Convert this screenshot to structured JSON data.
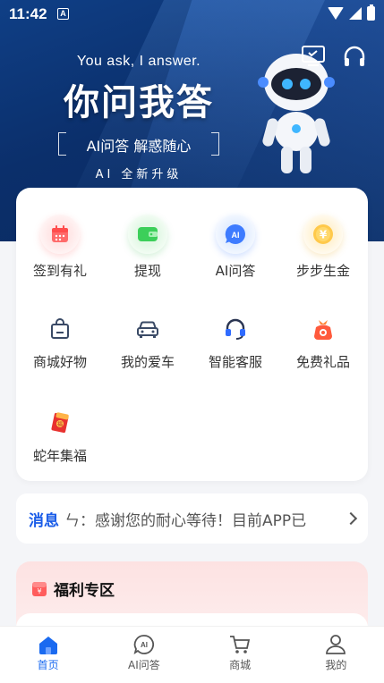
{
  "status_bar": {
    "time": "11:42",
    "notification_badge": "A"
  },
  "hero": {
    "subtitle": "You ask, I answer.",
    "title": "你问我答",
    "tagline": "AI问答 解惑随心",
    "upgrade": "AI 全新升级"
  },
  "menu": [
    {
      "label": "签到有礼",
      "icon": "calendar-icon"
    },
    {
      "label": "提现",
      "icon": "wallet-icon"
    },
    {
      "label": "AI问答",
      "icon": "ai-chat-icon"
    },
    {
      "label": "步步生金",
      "icon": "coin-icon"
    },
    {
      "label": "商城好物",
      "icon": "shopping-bag-icon"
    },
    {
      "label": "我的爱车",
      "icon": "car-icon"
    },
    {
      "label": "智能客服",
      "icon": "headset-icon"
    },
    {
      "label": "免费礼品",
      "icon": "gift-bag-icon"
    },
    {
      "label": "蛇年集福",
      "icon": "red-envelope-icon"
    }
  ],
  "message": {
    "title": "消息",
    "text": "ㄣ：感谢您的耐心等待！目前APP已"
  },
  "welfare": {
    "title": "福利专区"
  },
  "tabs": [
    {
      "label": "首页",
      "icon": "home-icon",
      "active": true
    },
    {
      "label": "AI问答",
      "icon": "ai-chat-icon",
      "active": false
    },
    {
      "label": "商城",
      "icon": "cart-icon",
      "active": false
    },
    {
      "label": "我的",
      "icon": "profile-icon",
      "active": false
    }
  ],
  "colors": {
    "accent": "#1a6af0",
    "hero_bg": "#0b2f6b",
    "message_title": "#1a5ce8"
  }
}
